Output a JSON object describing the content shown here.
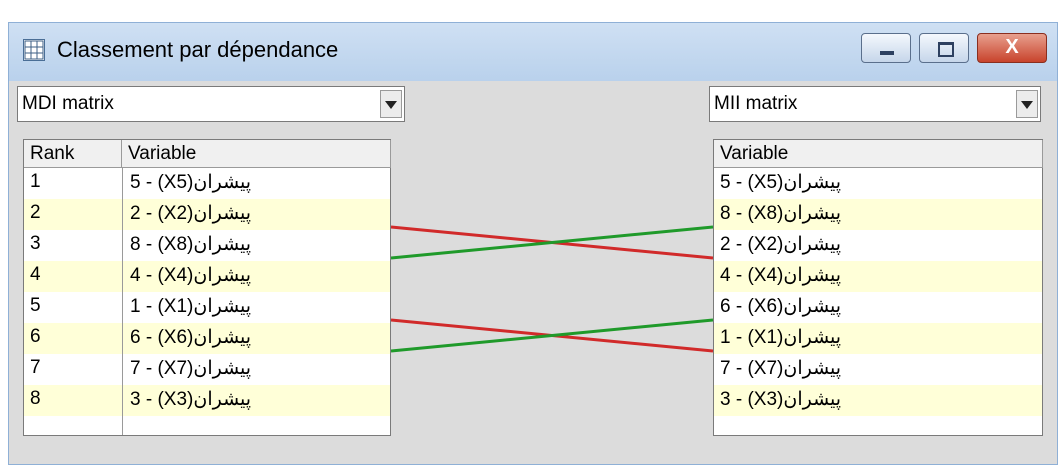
{
  "window": {
    "title": "Classement par dépendance",
    "close_label": "X"
  },
  "left_combo": {
    "value": "MDI matrix"
  },
  "right_combo": {
    "value": "MII matrix"
  },
  "left_table": {
    "headers": {
      "rank": "Rank",
      "variable": "Variable"
    },
    "rows": [
      {
        "rank": "1",
        "variable": "5 - (X5)پیشران"
      },
      {
        "rank": "2",
        "variable": "2 - (X2)پیشران"
      },
      {
        "rank": "3",
        "variable": "8 - (X8)پیشران"
      },
      {
        "rank": "4",
        "variable": "4 - (X4)پیشران"
      },
      {
        "rank": "5",
        "variable": "1 - (X1)پیشران"
      },
      {
        "rank": "6",
        "variable": "6 - (X6)پیشران"
      },
      {
        "rank": "7",
        "variable": "7 - (X7)پیشران"
      },
      {
        "rank": "8",
        "variable": "3 - (X3)پیشران"
      }
    ]
  },
  "right_table": {
    "headers": {
      "variable": "Variable"
    },
    "rows": [
      {
        "variable": "5 - (X5)پیشران"
      },
      {
        "variable": "8 - (X8)پیشران"
      },
      {
        "variable": "2 - (X2)پیشران"
      },
      {
        "variable": "4 - (X4)پیشران"
      },
      {
        "variable": "6 - (X6)پیشران"
      },
      {
        "variable": "1 - (X1)پیشران"
      },
      {
        "variable": "7 - (X7)پیشران"
      },
      {
        "variable": "3 - (X3)پیشران"
      }
    ]
  },
  "rank_changes": [
    {
      "from_rank": 2,
      "to_rank": 3,
      "color": "#d12a2a"
    },
    {
      "from_rank": 3,
      "to_rank": 2,
      "color": "#1f9a2a"
    },
    {
      "from_rank": 5,
      "to_rank": 6,
      "color": "#d12a2a"
    },
    {
      "from_rank": 6,
      "to_rank": 5,
      "color": "#1f9a2a"
    }
  ],
  "colors": {
    "row_alt": "#ffffd8",
    "down": "#d12a2a",
    "up": "#1f9a2a"
  }
}
